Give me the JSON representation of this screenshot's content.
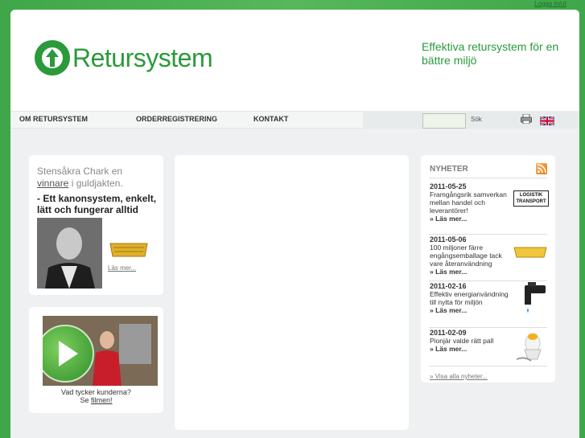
{
  "top": {
    "login_label": "Logga in/ut"
  },
  "header": {
    "logo_text": "Retursystem",
    "tagline": "Effektiva retursystem för en bättre miljö",
    "brand_color": "#2a9a3a"
  },
  "nav": {
    "items": [
      "OM RETURSYSTEM",
      "ORDERREGISTRERING",
      "KONTAKT"
    ],
    "search_placeholder": "",
    "search_button": "Sök",
    "print_icon": "printer-icon",
    "language_icon": "uk-flag-icon"
  },
  "promo": {
    "text_before": "Stensåkra Chark en",
    "link": "vinnare",
    "text_after": " i guldjakten.",
    "quote": "- Ett kanonsystem, enkelt, lätt och fungerar alltid",
    "read_more": "Läs mer..."
  },
  "video": {
    "caption": "Vad tycker kunderna?",
    "link_prefix": "Se ",
    "link": "filmen!"
  },
  "news": {
    "title": "NYHETER",
    "items": [
      {
        "date": "2011-05-25",
        "text": "Framgångsrik samverkan mellan handel och leverantörer!",
        "more": "» Läs mer...",
        "image": "logistik-transport-logo",
        "image_text": "LOGISTIK TRANSPORT"
      },
      {
        "date": "2011-05-06",
        "text": "100 miljoner färre engångsemballage tack vare återanvändning",
        "more": "» Läs mer...",
        "image": "yellow-crate"
      },
      {
        "date": "2011-02-16",
        "text": "Effektiv energianvändning till nytta för miljön",
        "more": "» Läs mer...",
        "image": "water-tap"
      },
      {
        "date": "2011-02-09",
        "text": "Pionjär valde rätt pall",
        "more": "» Läs mer...",
        "image": "egg-cup"
      }
    ],
    "all_link": "» Visa alla nyheter..."
  }
}
